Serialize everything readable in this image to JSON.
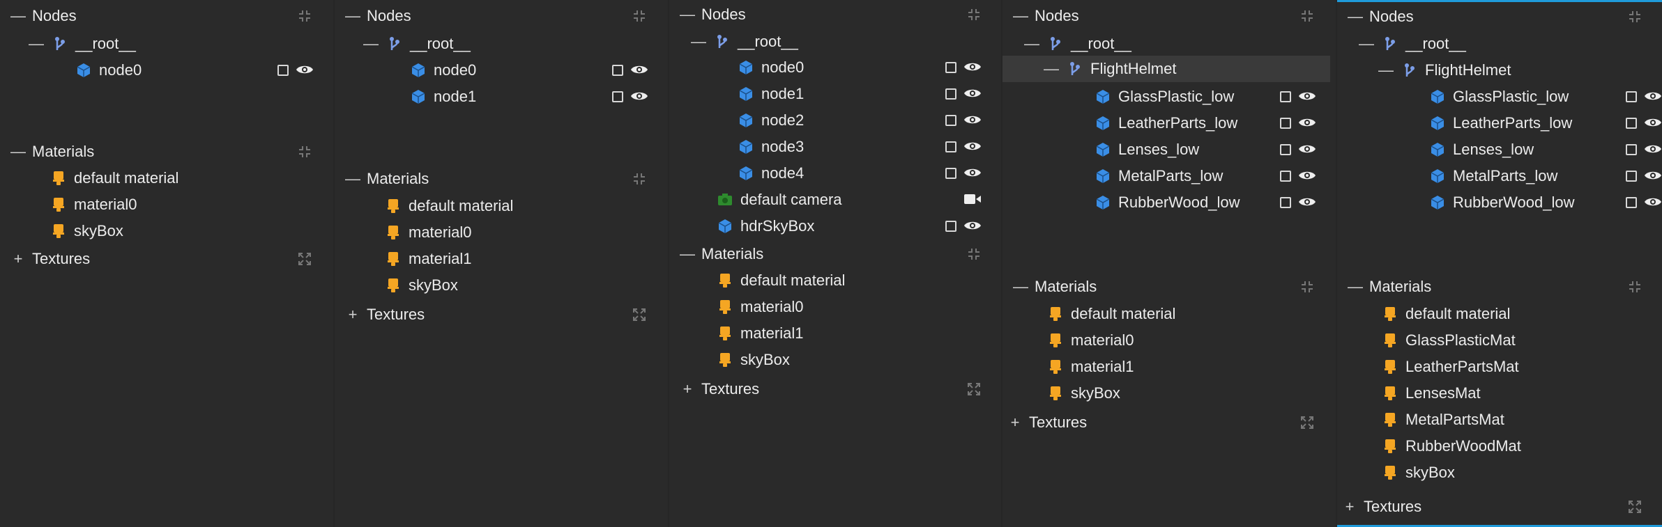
{
  "colors": {
    "background": "#262626",
    "panel": "#2a2a2a",
    "node_icon": "#3a8ee6",
    "material_icon": "#f5a623",
    "camera_icon": "#2e8b2e",
    "root_icon": "#7c9ee8",
    "accent_border": "#1f9bdb"
  },
  "labels": {
    "nodes": "Nodes",
    "materials": "Materials",
    "textures": "Textures",
    "root": "__root__",
    "flight_helmet": "FlightHelmet"
  },
  "panels": [
    {
      "nodes": [
        "node0"
      ],
      "materials": [
        "default material",
        "material0",
        "skyBox"
      ]
    },
    {
      "nodes": [
        "node0",
        "node1"
      ],
      "materials": [
        "default material",
        "material0",
        "material1",
        "skyBox"
      ]
    },
    {
      "nodes": [
        "node0",
        "node1",
        "node2",
        "node3",
        "node4"
      ],
      "extra": {
        "camera": "default camera",
        "skybox": "hdrSkyBox"
      },
      "materials": [
        "default material",
        "material0",
        "material1",
        "skyBox"
      ]
    },
    {
      "nodes": [
        "GlassPlastic_low",
        "LeatherParts_low",
        "Lenses_low",
        "MetalParts_low",
        "RubberWood_low"
      ],
      "materials": [
        "default material",
        "material0",
        "material1",
        "skyBox"
      ]
    },
    {
      "nodes": [
        "GlassPlastic_low",
        "LeatherParts_low",
        "Lenses_low",
        "MetalParts_low",
        "RubberWood_low"
      ],
      "materials": [
        "default material",
        "GlassPlasticMat",
        "LeatherPartsMat",
        "LensesMat",
        "MetalPartsMat",
        "RubberWoodMat",
        "skyBox"
      ]
    }
  ]
}
